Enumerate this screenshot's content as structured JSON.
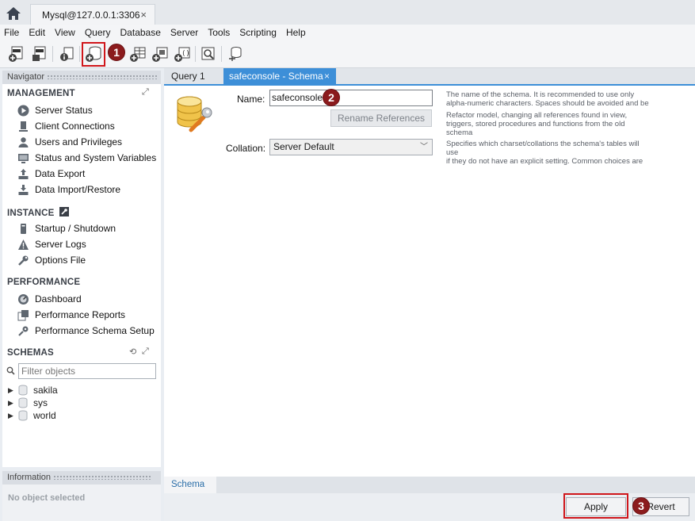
{
  "window": {
    "connection_tab": "Mysql@127.0.0.1:3306",
    "close_glyph": "×"
  },
  "menu": [
    "File",
    "Edit",
    "View",
    "Query",
    "Database",
    "Server",
    "Tools",
    "Scripting",
    "Help"
  ],
  "toolbar": {
    "icons": [
      "new-sql-tab-icon",
      "open-sql-script-icon",
      "schema-inspector-icon",
      "create-schema-icon",
      "create-table-icon",
      "create-view-icon",
      "create-procedure-icon",
      "create-function-icon",
      "search-table-data-icon",
      "reconnect-icon"
    ],
    "highlight_color": "#d0161b"
  },
  "badges": {
    "one": "1",
    "two": "2",
    "three": "3",
    "color": "#8b1b1d"
  },
  "navigator": {
    "header": "Navigator",
    "management": {
      "title": "MANAGEMENT",
      "items": [
        "Server Status",
        "Client Connections",
        "Users and Privileges",
        "Status and System Variables",
        "Data Export",
        "Data Import/Restore"
      ]
    },
    "instance": {
      "title": "INSTANCE",
      "items": [
        "Startup / Shutdown",
        "Server Logs",
        "Options File"
      ]
    },
    "performance": {
      "title": "PERFORMANCE",
      "items": [
        "Dashboard",
        "Performance Reports",
        "Performance Schema Setup"
      ]
    },
    "schemas": {
      "title": "SCHEMAS",
      "filter_placeholder": "Filter objects",
      "items": [
        "sakila",
        "sys",
        "world"
      ]
    }
  },
  "information": {
    "header": "Information",
    "text": "No object selected"
  },
  "editor": {
    "tabs": {
      "query": "Query 1",
      "schema": "safeconsole - Schema",
      "close": "×"
    },
    "name_label": "Name:",
    "name_value": "safeconsole",
    "rename_button": "Rename References",
    "collation_label": "Collation:",
    "collation_value": "Server Default",
    "help_name": [
      "The name of the schema. It is recommended to use only",
      "alpha-numeric characters. Spaces should be avoided and be"
    ],
    "help_rename": [
      "Refactor model, changing all references found in view,",
      "triggers, stored procedures and functions from the old schema"
    ],
    "help_collation": [
      "Specifies which charset/collations the schema's tables will use",
      "if they do not have an explicit setting. Common choices are"
    ],
    "bottom_tab": "Schema",
    "apply_button": "Apply",
    "revert_button": "Revert"
  },
  "colors": {
    "tab_active": "#3d8fd8",
    "panel_bg": "#ffffff"
  }
}
